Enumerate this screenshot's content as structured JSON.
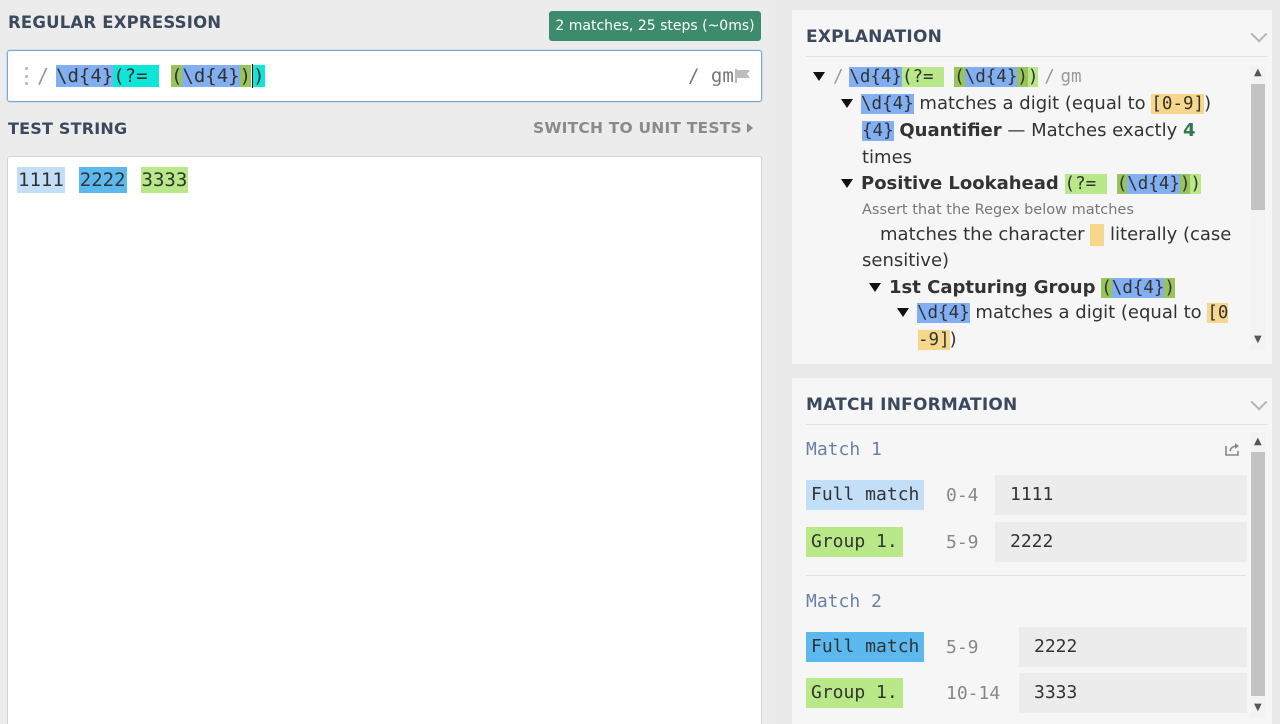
{
  "left": {
    "regex_title": "REGULAR EXPRESSION",
    "match_badge": "2 matches, 25 steps (~0ms)",
    "regex": {
      "open_slash": "/",
      "parts": [
        "\\d{4}",
        "(?= ",
        "(",
        "\\d{4}",
        ")",
        ")"
      ],
      "close_slash": "/",
      "flags": "gm"
    },
    "test_string_title": "TEST STRING",
    "switch_label": "SWITCH TO UNIT TESTS",
    "test_tokens": [
      "1111",
      "2222",
      "3333"
    ]
  },
  "explanation": {
    "title": "EXPLANATION",
    "root": {
      "slash_open": "/",
      "p1": "\\d{4}",
      "p2": "(?= ",
      "p3": "(",
      "p4": "\\d{4}",
      "p5": ")",
      "p6": ")",
      "slash_close": "/",
      "flags": "gm"
    },
    "item1": {
      "code": "\\d{4}",
      "text": "matches a digit (equal to ",
      "range": "[0-9]",
      "close": ")"
    },
    "quantifier": {
      "code": "{4}",
      "label": "Quantifier",
      "text": "— Matches exactly ",
      "count": "4",
      "tail": "times"
    },
    "lookahead": {
      "label": "Positive Lookahead",
      "code1": "(?= ",
      "code2": "(",
      "code3": "\\d{4}",
      "code4": ")",
      "code5": ")"
    },
    "assert_text": "Assert that the Regex below matches",
    "char_text_a": "matches the character",
    "char_text_b": "literally (case sensitive)",
    "group": {
      "label": "1st Capturing Group",
      "code1": "(",
      "code2": "\\d{4}",
      "code3": ")"
    },
    "item2": {
      "code": "\\d{4}",
      "text": "matches a digit (equal to ",
      "range_a": "[0",
      "range_b": "-9]",
      "close": ")"
    }
  },
  "match_info": {
    "title": "MATCH INFORMATION",
    "matches": [
      {
        "title": "Match 1",
        "rows": [
          {
            "label": "Full match",
            "range": "0-4",
            "value": "1111"
          },
          {
            "label": "Group 1.",
            "range": "5-9",
            "value": "2222"
          }
        ]
      },
      {
        "title": "Match 2",
        "rows": [
          {
            "label": "Full match",
            "range": "5-9",
            "value": "2222"
          },
          {
            "label": "Group 1.",
            "range": "10-14",
            "value": "3333"
          }
        ]
      }
    ]
  },
  "icons": [
    "drag-handle-icon",
    "flag-icon",
    "chevron-right-icon",
    "chevron-down-icon",
    "share-icon",
    "triangle-down-icon"
  ],
  "colors": {
    "badge": "#3d8b6d",
    "title": "#3a4a5c",
    "hl_blue": "#82aef2",
    "hl_cyan": "#0fe5d8",
    "hl_green": "#b8e887",
    "full_match_1": "#c3def7",
    "full_match_2": "#5cb9ef"
  }
}
